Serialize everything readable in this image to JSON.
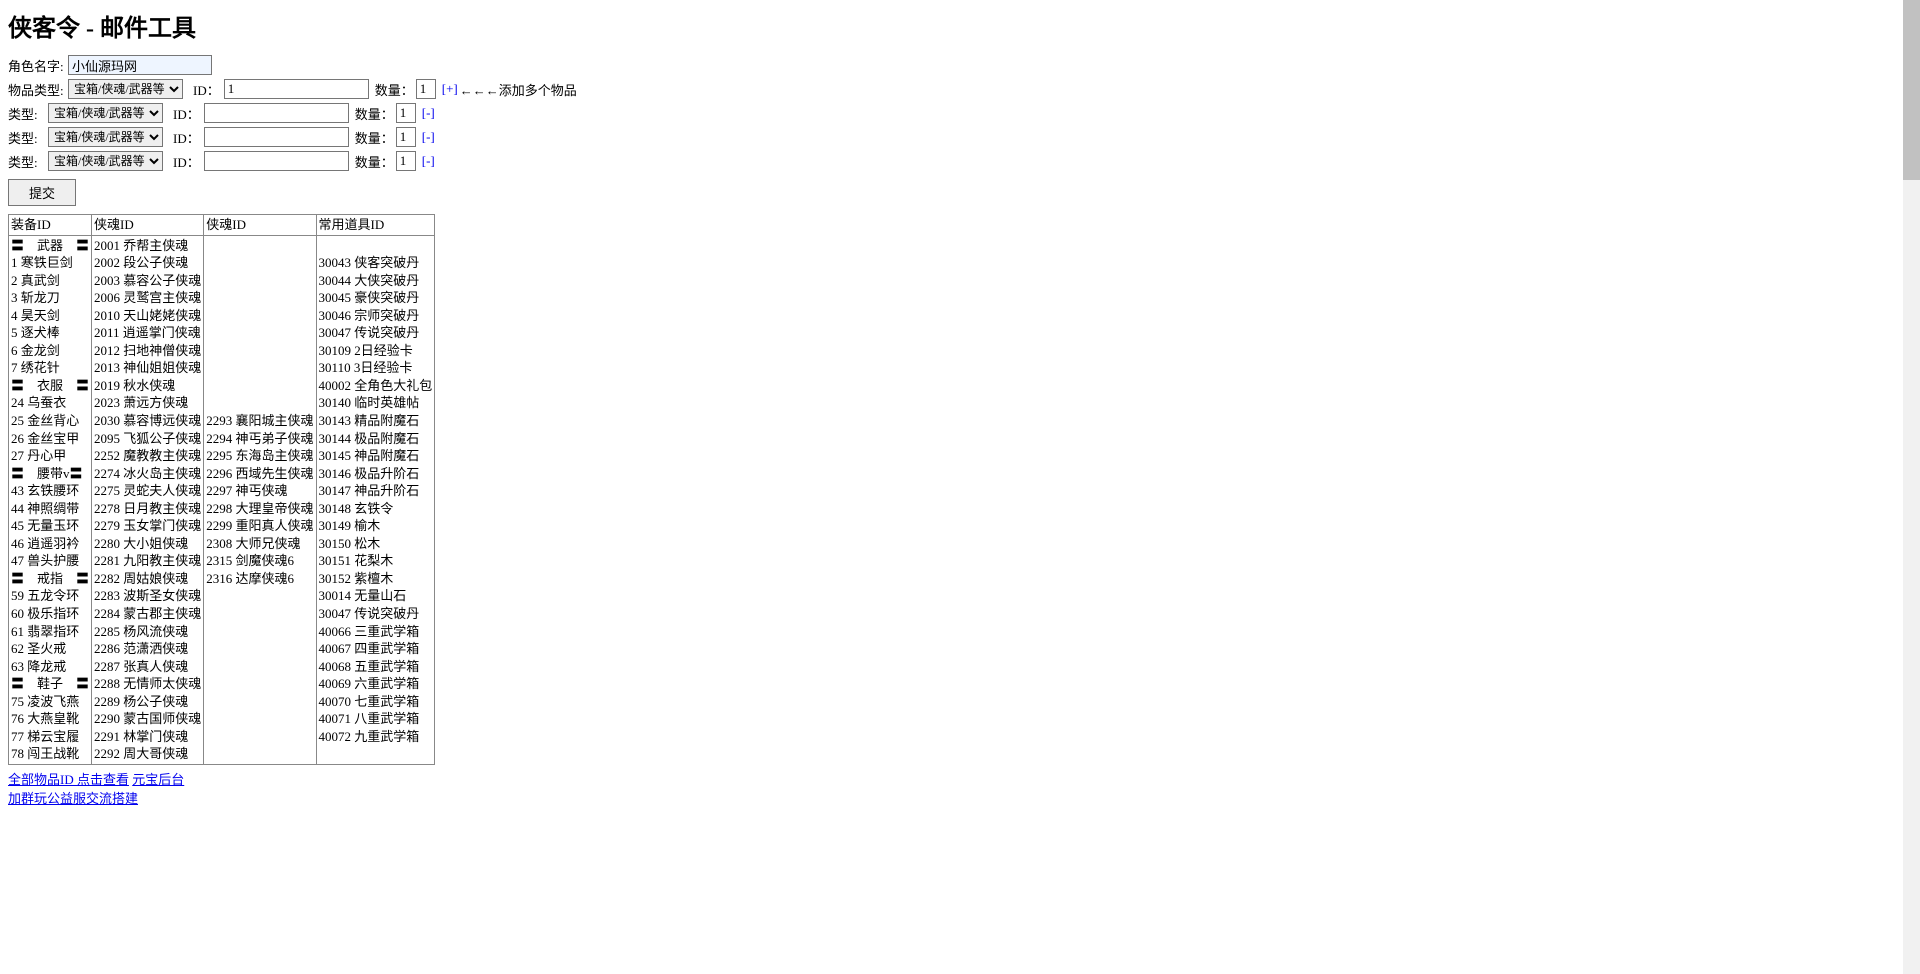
{
  "title": "侠客令 - 邮件工具",
  "form": {
    "role_label": "角色名字:",
    "role_value": "小仙源玛网",
    "rows": [
      {
        "type_label": "物品类型:",
        "select": "宝箱/侠魂/武器等",
        "id_label": "ID：",
        "id_value": "1",
        "qty_label": "数量：",
        "qty_value": "1",
        "action_label": "[+]",
        "hint": "←←←添加多个物品"
      },
      {
        "type_label": "类型:",
        "select": "宝箱/侠魂/武器等",
        "id_label": "ID：",
        "id_value": "",
        "qty_label": "数量：",
        "qty_value": "1",
        "action_label": "[-]",
        "hint": ""
      },
      {
        "type_label": "类型:",
        "select": "宝箱/侠魂/武器等",
        "id_label": "ID：",
        "id_value": "",
        "qty_label": "数量：",
        "qty_value": "1",
        "action_label": "[-]",
        "hint": ""
      },
      {
        "type_label": "类型:",
        "select": "宝箱/侠魂/武器等",
        "id_label": "ID：",
        "id_value": "",
        "qty_label": "数量：",
        "qty_value": "1",
        "action_label": "[-]",
        "hint": ""
      }
    ],
    "submit": "提交"
  },
  "table": {
    "headers": [
      "装备ID",
      "侠魂ID",
      "侠魂ID",
      "常用道具ID"
    ],
    "cols": [
      [
        "〓　武器　〓",
        "1 寒铁巨剑",
        "2 真武剑",
        "3 斩龙刀",
        "4 昊天剑",
        "5 逐犬棒",
        "6 金龙剑",
        "7 绣花针",
        "〓　衣服　〓",
        "24 乌蚕衣",
        "25 金丝背心",
        "26 金丝宝甲",
        "27 丹心甲",
        "〓　腰带v〓",
        "43 玄铁腰环",
        "44 神照绸带",
        "45 无量玉环",
        "46 逍遥羽衿",
        "47 兽头护腰",
        "〓　戒指　〓",
        "59 五龙令环",
        "60 极乐指环",
        "61 翡翠指环",
        "62 圣火戒",
        "63 降龙戒",
        "〓　鞋子　〓",
        "75 凌波飞燕",
        "76 大燕皇靴",
        "77 梯云宝履",
        "78 闯王战靴"
      ],
      [
        "2001 乔帮主侠魂",
        "2002 段公子侠魂",
        "2003 慕容公子侠魂",
        "2006 灵鹫宫主侠魂",
        "2010 天山姥姥侠魂",
        "2011 逍遥掌门侠魂",
        "2012 扫地神僧侠魂",
        "2013 神仙姐姐侠魂",
        "2019 秋水侠魂",
        "2023 萧远方侠魂",
        "2030 慕容博远侠魂",
        "2095 飞狐公子侠魂",
        "2252 魔教教主侠魂",
        "2274 冰火岛主侠魂",
        "2275 灵蛇夫人侠魂",
        "2278 日月教主侠魂",
        "2279 玉女掌门侠魂",
        "2280 大小姐侠魂",
        "2281 九阳教主侠魂",
        "2282 周姑娘侠魂",
        "2283 波斯圣女侠魂",
        "2284 蒙古郡主侠魂",
        "2285 杨风流侠魂",
        "2286 范潇洒侠魂",
        "2287 张真人侠魂",
        "2288 无情师太侠魂",
        "2289 杨公子侠魂",
        "2290 蒙古国师侠魂",
        "2291 林掌门侠魂",
        "2292 周大哥侠魂"
      ],
      [
        "",
        "",
        "",
        "",
        "",
        "",
        "",
        "",
        "",
        "",
        "2293 襄阳城主侠魂",
        "2294 神丐弟子侠魂",
        "2295 东海岛主侠魂",
        "2296 西域先生侠魂",
        "2297 神丐侠魂",
        "2298 大理皇帝侠魂",
        "2299 重阳真人侠魂",
        "2308 大师兄侠魂",
        "2315 剑魔侠魂6",
        "2316 达摩侠魂6",
        "",
        "",
        "",
        "",
        "",
        "",
        "",
        "",
        "",
        ""
      ],
      [
        "",
        "30043 侠客突破丹",
        "30044 大侠突破丹",
        "30045 豪侠突破丹",
        "30046 宗师突破丹",
        "30047 传说突破丹",
        "30109 2日经验卡",
        "30110 3日经验卡",
        "40002 全角色大礼包",
        "30140 临时英雄帖",
        "30143 精品附魔石",
        "30144 极品附魔石",
        "30145 神品附魔石",
        "30146 极品升阶石",
        "30147 神品升阶石",
        "30148 玄铁令",
        "30149 榆木",
        "30150 松木",
        "30151 花梨木",
        "30152 紫檀木",
        "30014 无量山石",
        "30047 传说突破丹",
        "40066 三重武学箱",
        "40067 四重武学箱",
        "40068 五重武学箱",
        "40069 六重武学箱",
        "40070 七重武学箱",
        "40071 八重武学箱",
        "40072 九重武学箱",
        ""
      ]
    ]
  },
  "links": {
    "all_items": "全部物品ID 点击查看",
    "yb": "元宝后台",
    "group": "加群玩公益服交流搭建"
  }
}
